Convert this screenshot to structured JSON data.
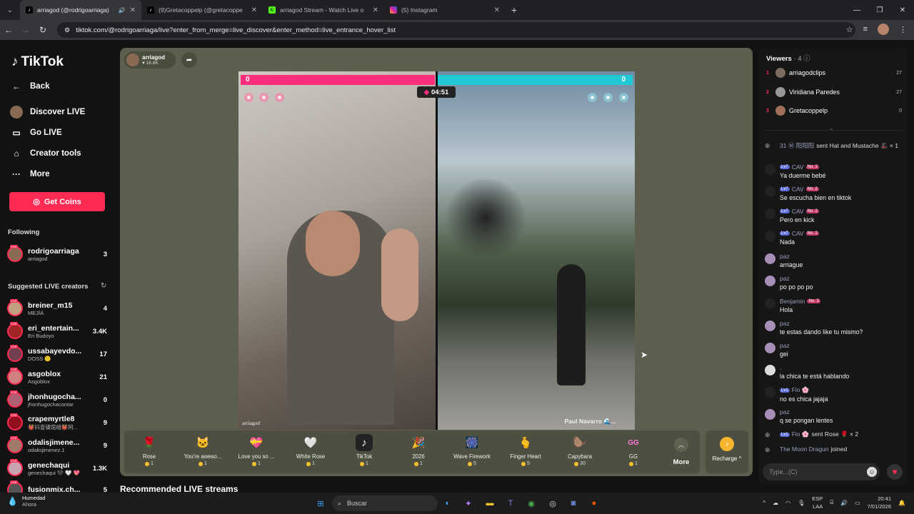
{
  "browser": {
    "tabs": [
      {
        "title": "arriagod (@rodrigoarriaga)",
        "active": true,
        "icon": "tiktok-icon"
      },
      {
        "title": "(9)Gretacoppelp (@gretacoppe",
        "active": false,
        "icon": "tiktok-icon"
      },
      {
        "title": "arriagod Stream - Watch Live o",
        "active": false,
        "icon": "kick-icon"
      },
      {
        "title": "(5) Instagram",
        "active": false,
        "icon": "instagram-icon"
      }
    ],
    "url": "tiktok.com/@rodrigoarriaga/live?enter_from_merge=live_discover&enter_method=live_entrance_hover_list"
  },
  "sidebar": {
    "logo": "TikTok",
    "back": "Back",
    "nav": [
      "Discover LIVE",
      "Go LIVE",
      "Creator tools",
      "More"
    ],
    "get_coins": "Get Coins",
    "following_title": "Following",
    "following": [
      {
        "name": "rodrigoarriaga",
        "sub": "arriagod",
        "count": "3"
      }
    ],
    "suggested_title": "Suggested LIVE creators",
    "suggested": [
      {
        "name": "breiner_m15",
        "sub": "MEJÍA",
        "count": "4"
      },
      {
        "name": "eri_entertain...",
        "sub": "Eri Budoyo",
        "count": "3.4K"
      },
      {
        "name": "ussabayevdo...",
        "sub": "DOSS 🙂",
        "count": "17"
      },
      {
        "name": "asgoblox",
        "sub": "Asgoblox",
        "count": "21"
      },
      {
        "name": "jhonhugocha...",
        "sub": "jhonhugochacontar",
        "count": "0"
      },
      {
        "name": "crapemyrtle8",
        "sub": "👹抖音镇馆组👹阿...",
        "count": "9"
      },
      {
        "name": "odalisjimene...",
        "sub": "odalisjimenez.1",
        "count": "9"
      },
      {
        "name": "genechaqui",
        "sub": "genechaqui 🖤 🤍 💖",
        "count": "1.3K"
      },
      {
        "name": "fusionmix.ch...",
        "sub": "",
        "count": "5"
      }
    ]
  },
  "stream": {
    "host": "arriagod",
    "likes": "16.8K",
    "score_left": "0",
    "score_right": "0",
    "timer": "04:51",
    "label_left": "arriagod",
    "label_right": "Paul Navarro 🌊..."
  },
  "gifts": [
    {
      "name": "Rose",
      "price": "1",
      "icon": "🌹"
    },
    {
      "name": "You're aweso...",
      "price": "1",
      "icon": "🐱"
    },
    {
      "name": "Love you so ...",
      "price": "1",
      "icon": "💝"
    },
    {
      "name": "White Rose",
      "price": "1",
      "icon": "🤍"
    },
    {
      "name": "TikTok",
      "price": "1",
      "icon": "♪"
    },
    {
      "name": "2026",
      "price": "1",
      "icon": "🎉"
    },
    {
      "name": "Wave Firework",
      "price": "5",
      "icon": "🎆"
    },
    {
      "name": "Finger Heart",
      "price": "5",
      "icon": "🫰"
    },
    {
      "name": "Capybara",
      "price": "30",
      "icon": "🦫"
    },
    {
      "name": "GG",
      "price": "1",
      "icon": "GG"
    }
  ],
  "gift_more": "More",
  "recharge": "Recharge",
  "recommended_title": "Recommended LIVE streams",
  "viewers": {
    "title": "Viewers",
    "count": "4",
    "list": [
      {
        "rank": "1",
        "name": "arriagodclips",
        "score": "27"
      },
      {
        "rank": "2",
        "name": "Viridiana Paredes",
        "score": "27"
      },
      {
        "rank": "3",
        "name": "Gretacoppelp",
        "score": "0"
      }
    ]
  },
  "chat": [
    {
      "user": "31  Ⓜ 阳阳阳",
      "level": "",
      "rank": "",
      "msg": "sent Hat and Mustache 🎩 × 1",
      "avatar": "system"
    },
    {
      "user": "CAV",
      "level": "7",
      "rank": "No. 2",
      "msg": "Ya duerme bebé",
      "avatar": "dark"
    },
    {
      "user": "CAV",
      "level": "7",
      "rank": "No. 2",
      "msg": "Se escucha bien en tiktok",
      "avatar": "dark"
    },
    {
      "user": "CAV",
      "level": "7",
      "rank": "No. 2",
      "msg": "Pero en kick",
      "avatar": "dark"
    },
    {
      "user": "CAV",
      "level": "7",
      "rank": "No. 2",
      "msg": "Nada",
      "avatar": "dark"
    },
    {
      "user": "paz",
      "level": "",
      "rank": "",
      "msg": "arriague",
      "avatar": "purple"
    },
    {
      "user": "paz",
      "level": "",
      "rank": "",
      "msg": "po po po po",
      "avatar": "purple"
    },
    {
      "user": "Benjamin",
      "level": "",
      "rank": "No. 3",
      "msg": "Hola",
      "avatar": "dark"
    },
    {
      "user": "paz",
      "level": "",
      "rank": "",
      "msg": "te estas dando like tu mismo?",
      "avatar": "purple"
    },
    {
      "user": "paz",
      "level": "",
      "rank": "",
      "msg": "gei",
      "avatar": "purple"
    },
    {
      "user": ".",
      "level": "",
      "rank": "",
      "msg": "la chica te está hablando",
      "avatar": "white"
    },
    {
      "user": "Fio 🌸",
      "level": "1",
      "rank": "",
      "msg": "no es chica jajaja",
      "avatar": "dark"
    },
    {
      "user": "paz",
      "level": "",
      "rank": "",
      "msg": "q se pongan lentes",
      "avatar": "purple"
    },
    {
      "user": "Fio 🌸",
      "level": "1",
      "rank": "",
      "msg": "sent Rose 🌹 × 2",
      "avatar": "system"
    },
    {
      "user": "The Moon Dragun",
      "level": "",
      "rank": "",
      "msg": "joined",
      "avatar": "system"
    }
  ],
  "chat_placeholder": "Type...(C)",
  "taskbar": {
    "weather_title": "Humedad",
    "weather_sub": "Ahora",
    "search": "Buscar",
    "lang": "ESP",
    "lang2": "LAA",
    "time": "20:41",
    "date": "7/01/2026"
  }
}
